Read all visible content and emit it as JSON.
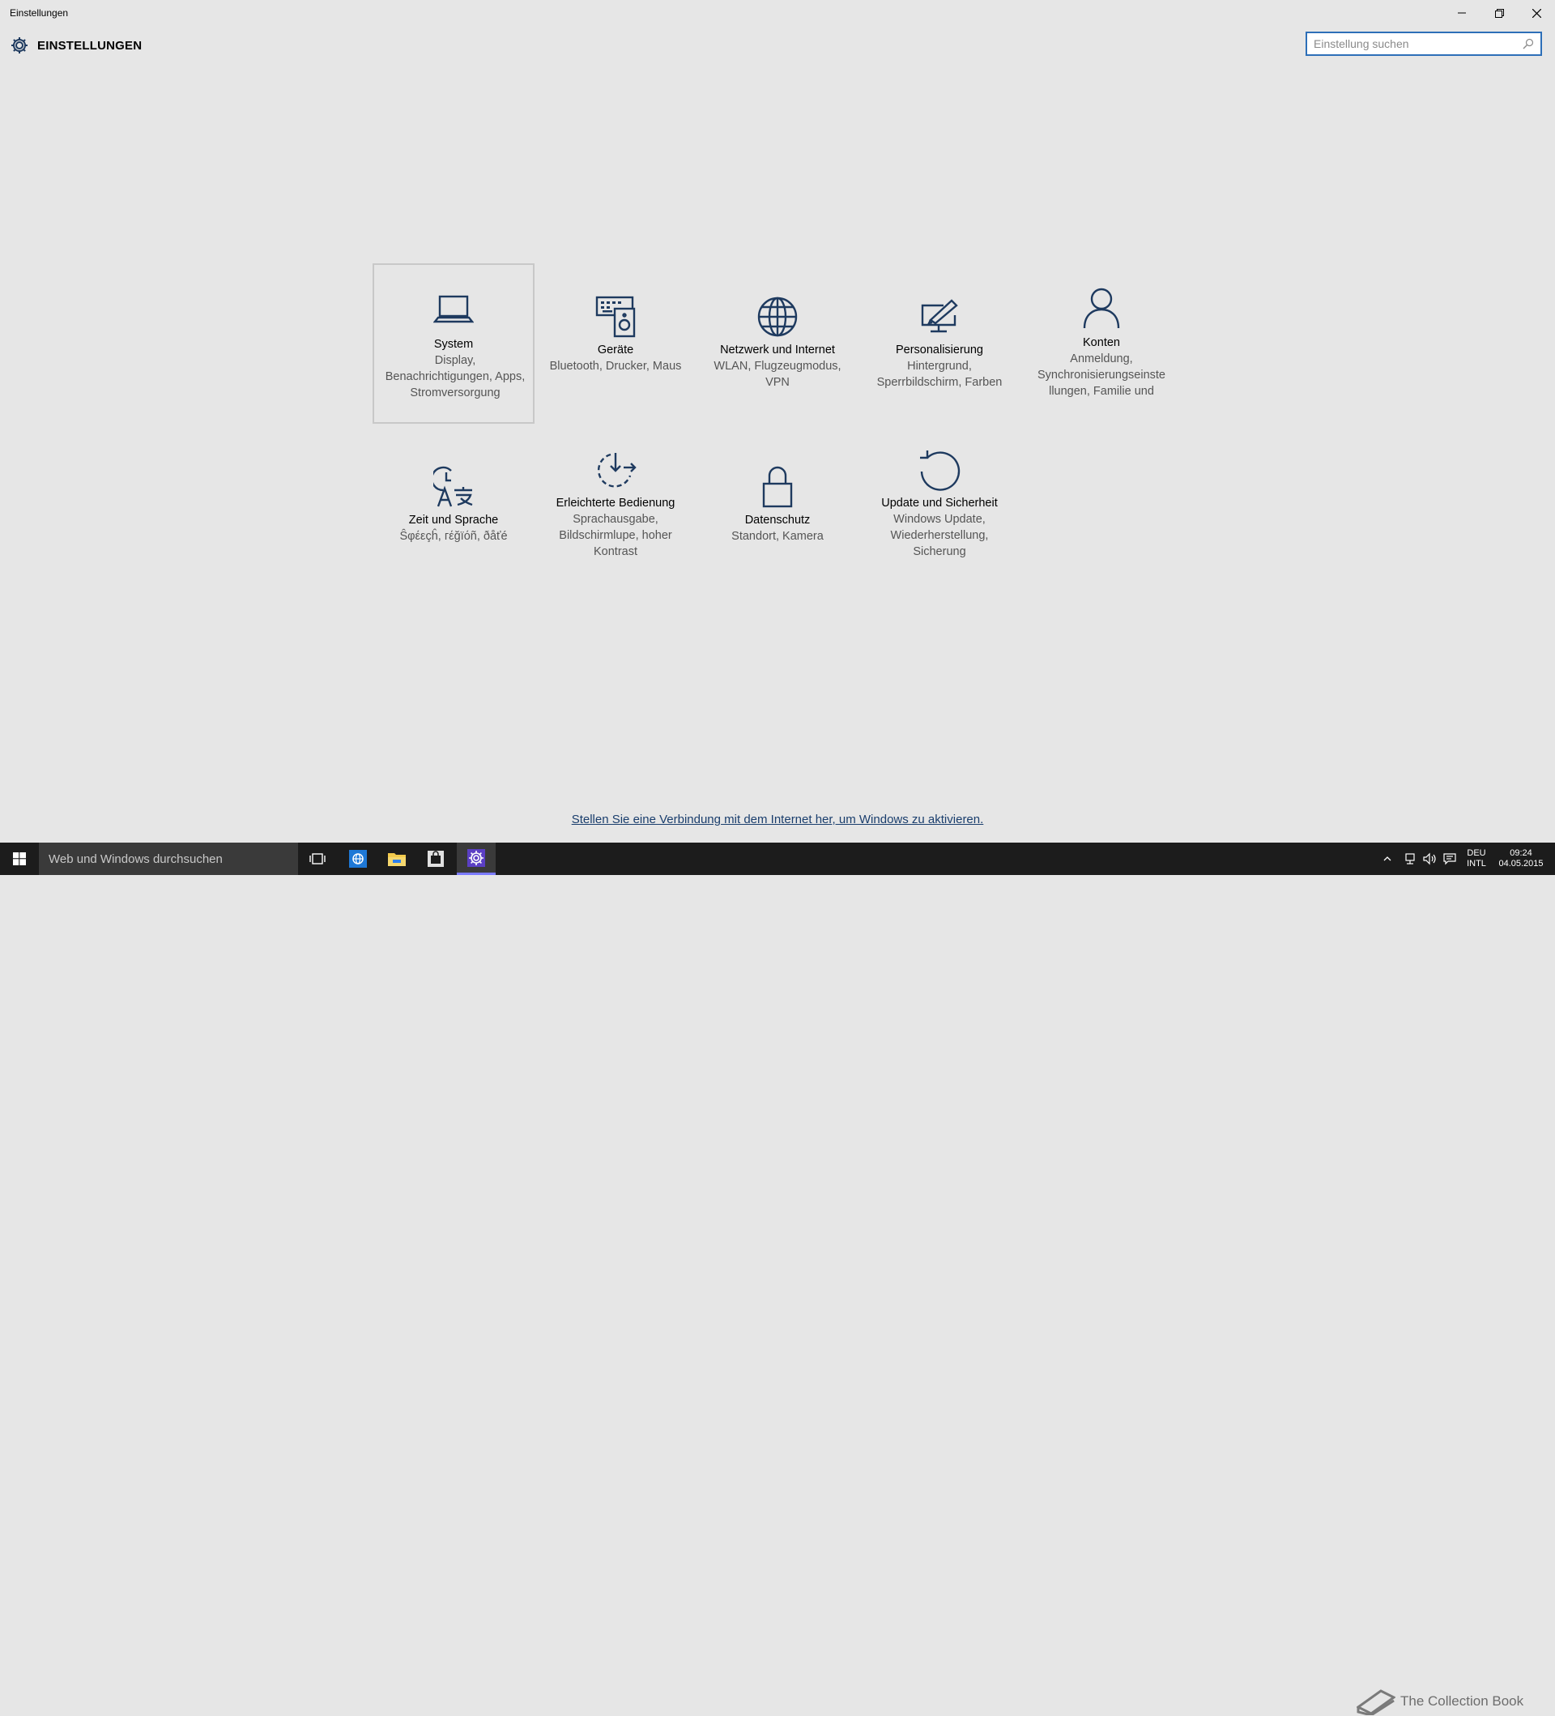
{
  "window": {
    "title": "Einstellungen",
    "minimize_icon": "minimize-icon",
    "restore_icon": "restore-icon",
    "close_icon": "close-icon"
  },
  "header": {
    "icon": "gear-icon",
    "title": "EINSTELLUNGEN"
  },
  "search": {
    "placeholder": "Einstellung suchen",
    "icon": "search-icon"
  },
  "categories": [
    {
      "title": "System",
      "desc": "Display, Benachrichtigungen, Apps, Stromversorgung",
      "icon": "laptop-icon",
      "selected": true
    },
    {
      "title": "Geräte",
      "desc": "Bluetooth, Drucker, Maus",
      "icon": "devices-icon"
    },
    {
      "title": "Netzwerk und Internet",
      "desc": "WLAN, Flugzeugmodus, VPN",
      "icon": "globe-icon"
    },
    {
      "title": "Personalisierung",
      "desc": "Hintergrund, Sperrbildschirm, Farben",
      "icon": "brush-screen-icon"
    },
    {
      "title": "Konten",
      "desc": "Anmeldung, Synchronisierungseinste llungen, Familie und",
      "icon": "person-icon"
    },
    {
      "title": "Zeit und Sprache",
      "desc": "Ŝφέεçĥ, гέğïόñ, ðåťé",
      "icon": "time-language-icon"
    },
    {
      "title": "Erleichterte Bedienung",
      "desc": "Sprachausgabe, Bildschirmlupe, hoher Kontrast",
      "icon": "ease-of-access-icon"
    },
    {
      "title": "Datenschutz",
      "desc": "Standort, Kamera",
      "icon": "lock-icon"
    },
    {
      "title": "Update und Sicherheit",
      "desc": "Windows Update, Wiederherstellung, Sicherung",
      "icon": "refresh-icon"
    }
  ],
  "activation_link": "Stellen Sie eine Verbindung mit dem Internet her, um Windows zu aktivieren.",
  "taskbar": {
    "search_placeholder": "Web und Windows durchsuchen",
    "tray": {
      "lang_top": "DEU",
      "lang_bottom": "INTL",
      "time": "09:24",
      "date": "04.05.2015"
    },
    "watermark": "The Collection Book"
  },
  "colors": {
    "background": "#e6e6e6",
    "accent": "#2d6fb8",
    "icon": "#1e3a5f",
    "taskbar": "#1c1c1c"
  }
}
